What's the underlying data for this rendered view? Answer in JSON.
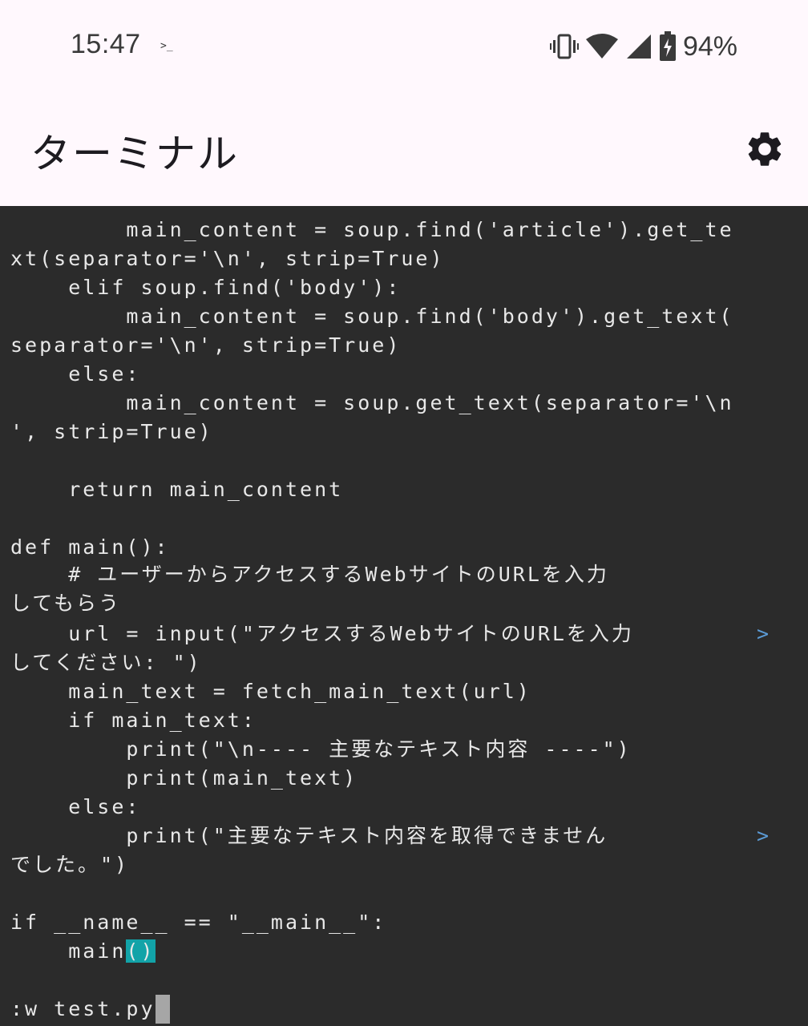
{
  "status_bar": {
    "time": "15:47",
    "notification_glyph": ">_",
    "battery_percent": "94%"
  },
  "app_bar": {
    "title": "ターミナル",
    "settings_icon": "gear-icon"
  },
  "terminal": {
    "lines": [
      "        main_content = soup.find('article').get_te",
      "xt(separator='\\n', strip=True)",
      "    elif soup.find('body'):",
      "        main_content = soup.find('body').get_text(",
      "separator='\\n', strip=True)",
      "    else:",
      "        main_content = soup.get_text(separator='\\n",
      "', strip=True)",
      "",
      "    return main_content",
      "",
      "def main():",
      "    # ユーザーからアクセスするWebサイトのURLを入力",
      "してもらう",
      "    url = input(\"アクセスするWebサイトのURLを入力",
      "してください: \")",
      "    main_text = fetch_main_text(url)",
      "    if main_text:",
      "        print(\"\\n---- 主要なテキスト内容 ----\")",
      "        print(main_text)",
      "    else:",
      "        print(\"主要なテキスト内容を取得できません",
      "でした。\")",
      "",
      "if __name__ == \"__main__\":",
      "    main",
      "",
      ":w test.py"
    ],
    "highlight_text": "()",
    "wrap_marker": ">"
  },
  "colors": {
    "terminal_bg": "#2b2b2b",
    "terminal_fg": "#e8e8e8",
    "bracket_highlight": "#12a3a8",
    "wrap_marker": "#5b9bd5",
    "cursor": "#a6a6a6"
  }
}
